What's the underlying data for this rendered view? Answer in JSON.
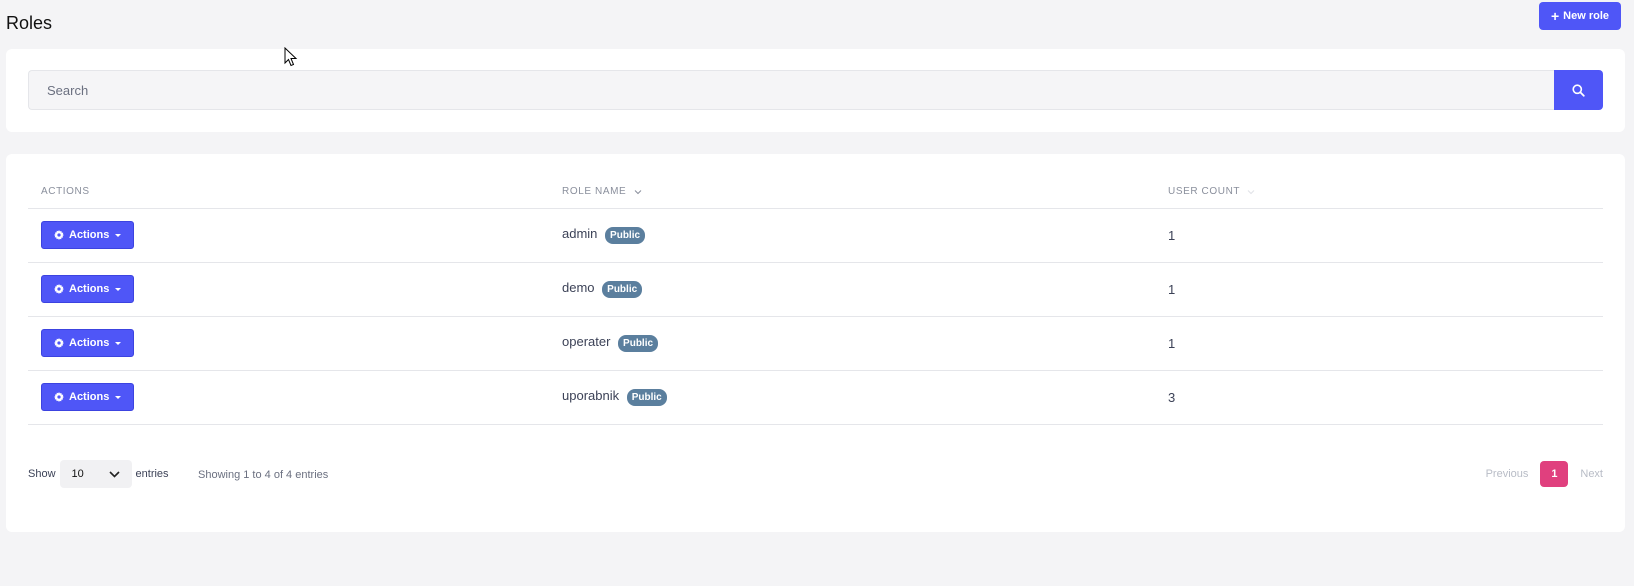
{
  "header": {
    "title": "Roles",
    "new_role_label": "New role"
  },
  "search": {
    "placeholder": "Search"
  },
  "table": {
    "columns": {
      "actions": "ACTIONS",
      "role_name": "ROLE NAME",
      "user_count": "USER COUNT"
    },
    "rows": [
      {
        "action_label": "Actions",
        "role_name": "admin",
        "badge": "Public",
        "user_count": "1"
      },
      {
        "action_label": "Actions",
        "role_name": "demo",
        "badge": "Public",
        "user_count": "1"
      },
      {
        "action_label": "Actions",
        "role_name": "operater",
        "badge": "Public",
        "user_count": "1"
      },
      {
        "action_label": "Actions",
        "role_name": "uporabnik",
        "badge": "Public",
        "user_count": "3"
      }
    ]
  },
  "footer": {
    "show_label": "Show",
    "entries_value": "10",
    "entries_label": "entries",
    "showing_text": "Showing 1 to 4 of 4 entries",
    "previous_label": "Previous",
    "current_page": "1",
    "next_label": "Next"
  },
  "colors": {
    "primary": "#4f56f7",
    "badge": "#5b7f9e",
    "active_page": "#e0407e"
  },
  "icons": {
    "new_role": "plus-icon",
    "search": "search-icon",
    "actions": "gear-icon",
    "sort": "chevron-down-icon",
    "select": "chevron-down-icon"
  }
}
